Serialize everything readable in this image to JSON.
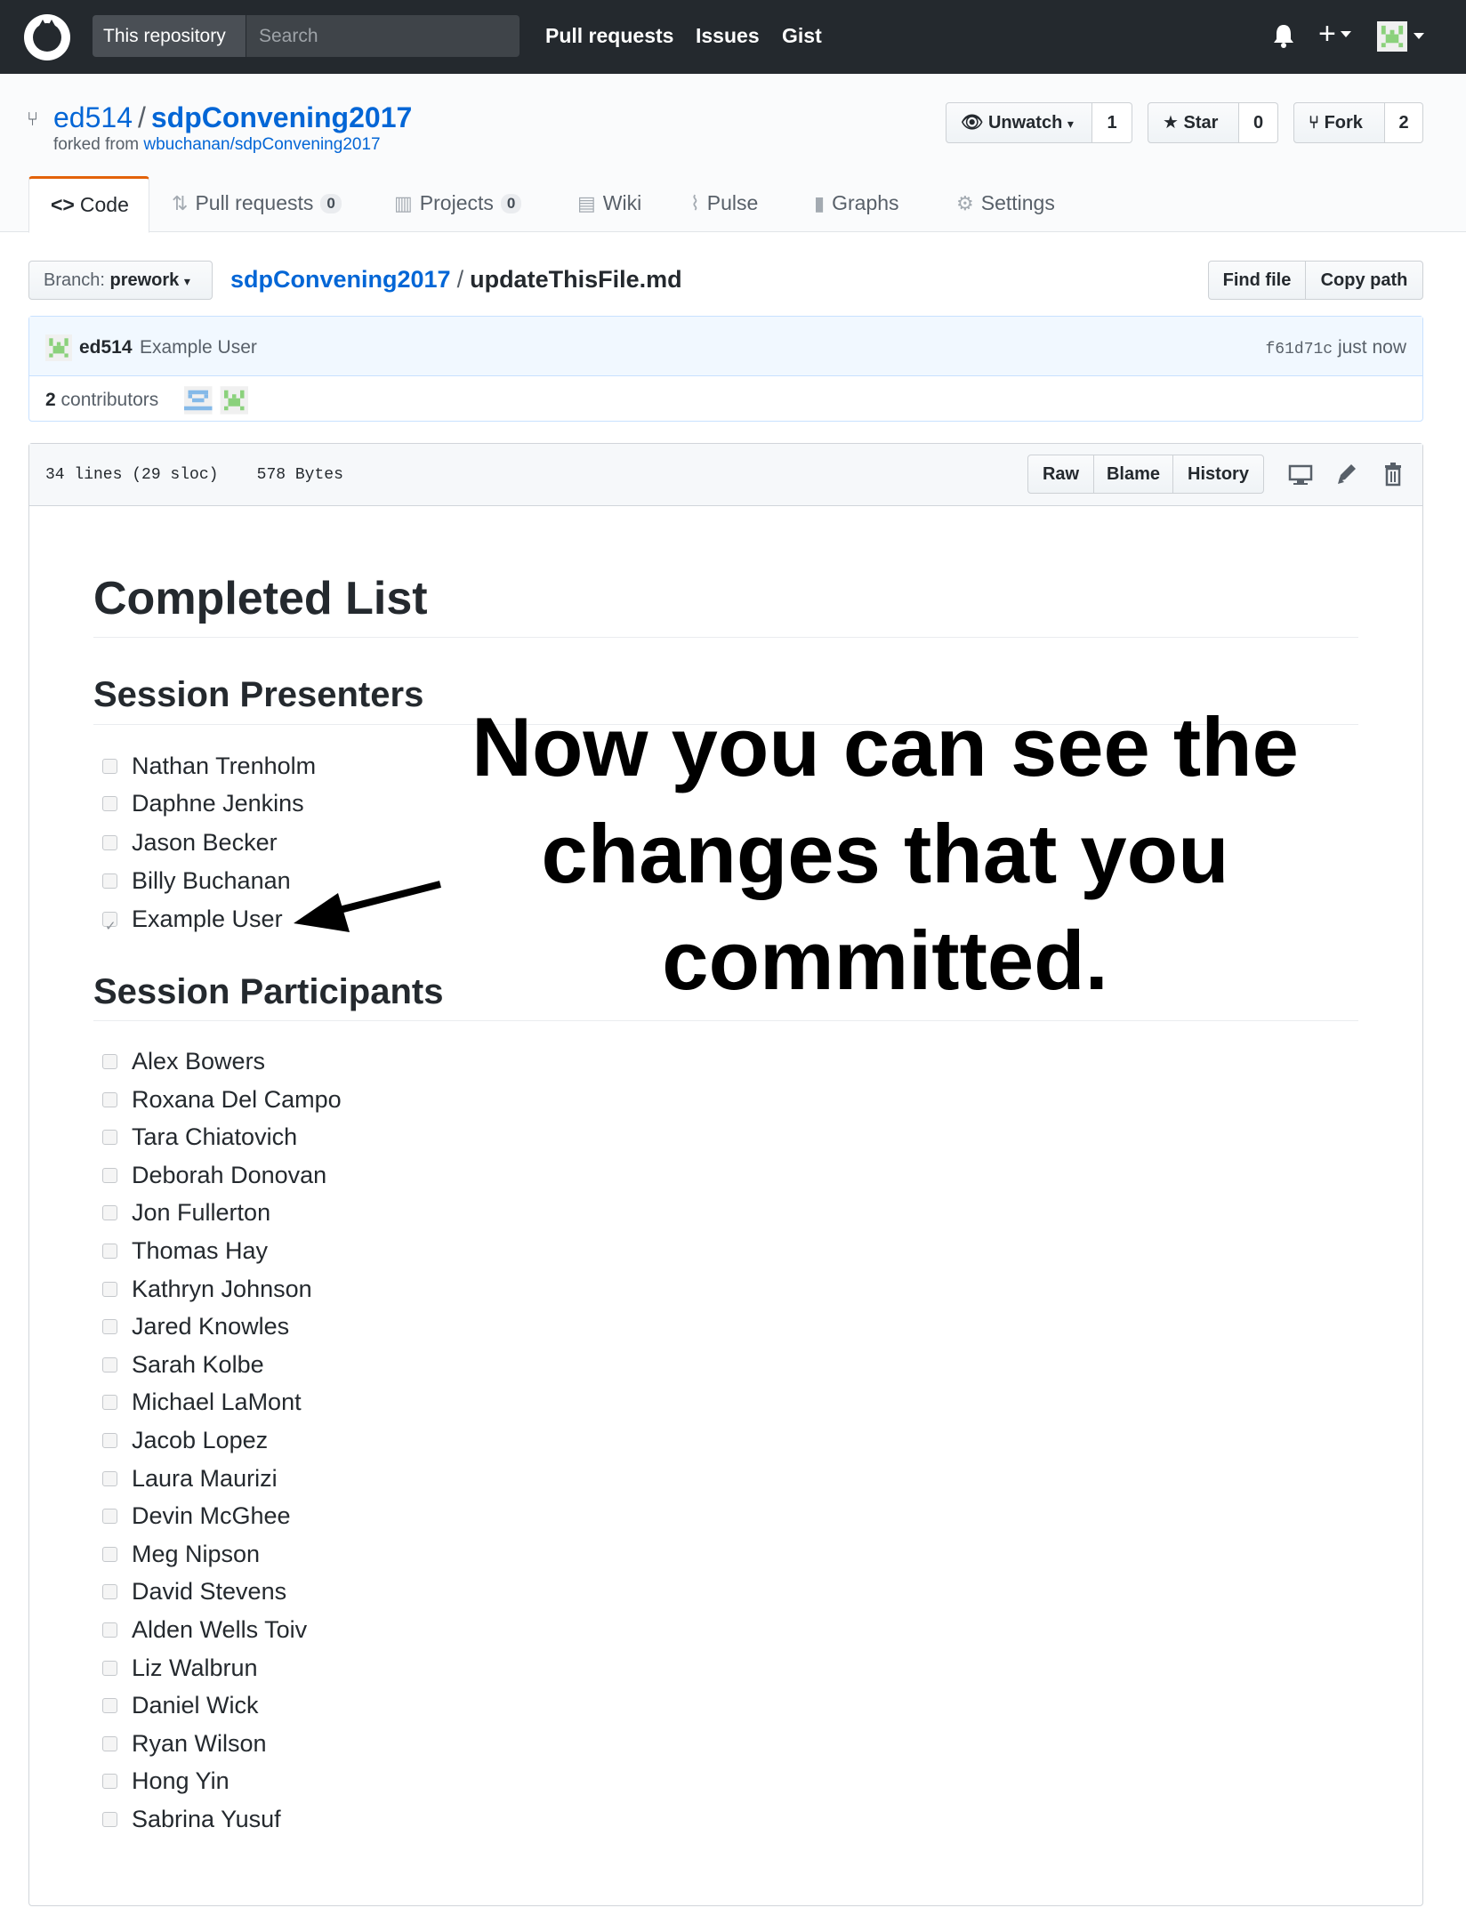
{
  "header": {
    "scope_label": "This repository",
    "search_placeholder": "Search",
    "nav": [
      "Pull requests",
      "Issues",
      "Gist"
    ],
    "plus_label": "+"
  },
  "repo": {
    "owner": "ed514",
    "separator": "/",
    "name": "sdpConvening2017",
    "forked_from_prefix": "forked from ",
    "forked_from_link": "wbuchanan/sdpConvening2017",
    "actions": {
      "unwatch_label": "Unwatch",
      "unwatch_count": "1",
      "star_label": "Star",
      "star_count": "0",
      "fork_label": "Fork",
      "fork_count": "2"
    }
  },
  "tabs": {
    "code": "Code",
    "pull_requests": "Pull requests",
    "pull_requests_count": "0",
    "projects": "Projects",
    "projects_count": "0",
    "wiki": "Wiki",
    "pulse": "Pulse",
    "graphs": "Graphs",
    "settings": "Settings"
  },
  "file_nav": {
    "branch_prefix": "Branch: ",
    "branch_name": "prework",
    "breadcrumb_repo": "sdpConvening2017",
    "breadcrumb_separator": "/",
    "breadcrumb_file": "updateThisFile.md",
    "find_file": "Find file",
    "copy_path": "Copy path"
  },
  "commit": {
    "author": "ed514",
    "message": "Example User",
    "sha": "f61d71c",
    "time": "just now",
    "contributors_count": "2",
    "contributors_label": "contributors"
  },
  "file": {
    "lines": "34 lines (29 sloc)",
    "size": "578 Bytes",
    "raw": "Raw",
    "blame": "Blame",
    "history": "History"
  },
  "markdown": {
    "h1": "Completed List",
    "presenters_heading": "Session Presenters",
    "presenters": [
      {
        "name": "Nathan Trenholm",
        "checked": false
      },
      {
        "name": "Daphne Jenkins",
        "checked": false
      },
      {
        "name": "Jason Becker",
        "checked": false
      },
      {
        "name": "Billy Buchanan",
        "checked": false
      },
      {
        "name": "Example User",
        "checked": true
      }
    ],
    "participants_heading": "Session Participants",
    "participants": [
      "Alex Bowers",
      "Roxana Del Campo",
      "Tara Chiatovich",
      "Deborah Donovan",
      "Jon Fullerton",
      "Thomas Hay",
      "Kathryn Johnson",
      "Jared Knowles",
      "Sarah Kolbe",
      "Michael LaMont",
      "Jacob Lopez",
      "Laura Maurizi",
      "Devin McGhee",
      "Meg Nipson",
      "David Stevens",
      "Alden Wells Toiv",
      "Liz Walbrun",
      "Daniel Wick",
      "Ryan Wilson",
      "Hong Yin",
      "Sabrina Yusuf"
    ]
  },
  "annotation": {
    "line1": "Now you can see the",
    "line2": "changes that you",
    "line3": "committed."
  }
}
